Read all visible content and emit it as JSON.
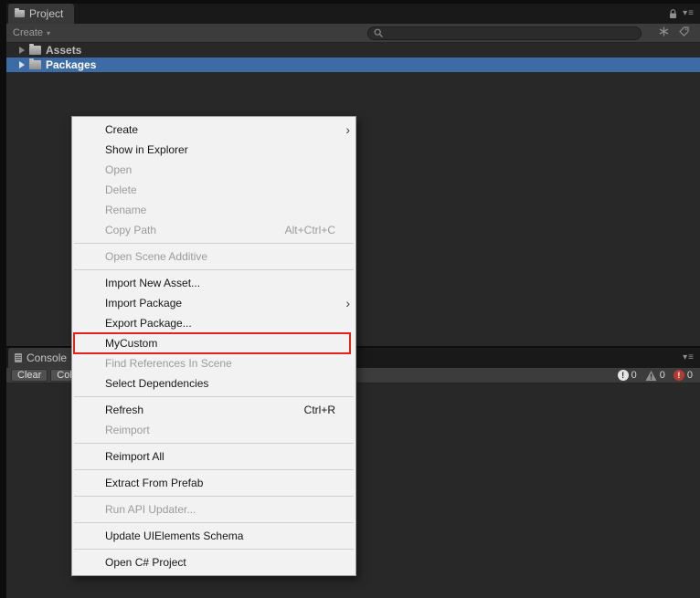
{
  "project_panel": {
    "tab": "Project",
    "create_button": "Create",
    "search_value": "",
    "tree": [
      {
        "label": "Assets",
        "selected": false
      },
      {
        "label": "Packages",
        "selected": true
      }
    ]
  },
  "console_panel": {
    "tab": "Console",
    "clear_button": "Clear",
    "collapse_button": "Col",
    "counts": {
      "info": "0",
      "warnings": "0",
      "errors": "0"
    }
  },
  "context_menu": {
    "items": [
      {
        "label": "Create",
        "submenu": true,
        "enabled": true
      },
      {
        "label": "Show in Explorer",
        "enabled": true
      },
      {
        "label": "Open",
        "enabled": false
      },
      {
        "label": "Delete",
        "enabled": false
      },
      {
        "label": "Rename",
        "enabled": false
      },
      {
        "label": "Copy Path",
        "shortcut": "Alt+Ctrl+C",
        "enabled": false
      },
      {
        "separator": true
      },
      {
        "label": "Open Scene Additive",
        "enabled": false
      },
      {
        "separator": true
      },
      {
        "label": "Import New Asset...",
        "enabled": true
      },
      {
        "label": "Import Package",
        "submenu": true,
        "enabled": true
      },
      {
        "label": "Export Package...",
        "enabled": true
      },
      {
        "label": "MyCustom",
        "enabled": true,
        "highlighted": true
      },
      {
        "label": "Find References In Scene",
        "enabled": false
      },
      {
        "label": "Select Dependencies",
        "enabled": true
      },
      {
        "separator": true
      },
      {
        "label": "Refresh",
        "shortcut": "Ctrl+R",
        "enabled": true
      },
      {
        "label": "Reimport",
        "enabled": false
      },
      {
        "separator": true
      },
      {
        "label": "Reimport All",
        "enabled": true
      },
      {
        "separator": true
      },
      {
        "label": "Extract From Prefab",
        "enabled": true
      },
      {
        "separator": true
      },
      {
        "label": "Run API Updater...",
        "enabled": false
      },
      {
        "separator": true
      },
      {
        "label": "Update UIElements Schema",
        "enabled": true
      },
      {
        "separator": true
      },
      {
        "label": "Open C# Project",
        "enabled": true
      }
    ]
  },
  "icons": {
    "project-tab-icon": "folder",
    "console-tab-icon": "document",
    "lock-icon": "padlock",
    "panel-menu-icon": "▾≡",
    "caret-down-icon": "▾",
    "search-icon": "magnifier",
    "search-by-type-icon": "asterisk",
    "search-by-label-icon": "tag",
    "foldout-arrow-icon": "▶",
    "folder-icon": "folder",
    "info-icon": "!",
    "warning-icon": "⚠",
    "error-icon": "!",
    "submenu-arrow-icon": "›"
  },
  "colors": {
    "selection_blue": "#3d6ba6",
    "menu_highlight_red": "#e5231b",
    "panel_bg": "#282828",
    "toolbar_bg": "#3c3c3c",
    "menu_bg": "#f2f2f2"
  }
}
